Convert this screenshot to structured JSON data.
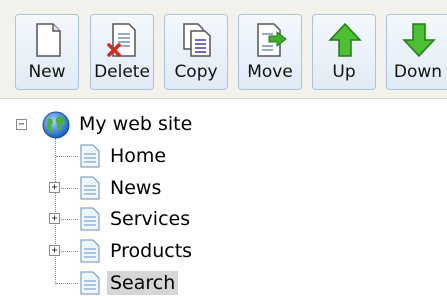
{
  "toolbar": {
    "buttons": [
      {
        "id": "new",
        "label": "New",
        "icon": "new-page-icon"
      },
      {
        "id": "delete",
        "label": "Delete",
        "icon": "delete-page-icon"
      },
      {
        "id": "copy",
        "label": "Copy",
        "icon": "copy-page-icon"
      },
      {
        "id": "move",
        "label": "Move",
        "icon": "move-page-icon"
      },
      {
        "id": "up",
        "label": "Up",
        "icon": "up-arrow-icon"
      },
      {
        "id": "down",
        "label": "Down",
        "icon": "down-arrow-icon"
      }
    ]
  },
  "tree": {
    "root": {
      "label": "My web site",
      "icon": "globe-icon",
      "expanded": true
    },
    "children": [
      {
        "label": "Home",
        "icon": "page-icon",
        "expandable": false,
        "selected": false
      },
      {
        "label": "News",
        "icon": "page-icon",
        "expandable": true,
        "selected": false
      },
      {
        "label": "Services",
        "icon": "page-icon",
        "expandable": true,
        "selected": false
      },
      {
        "label": "Products",
        "icon": "page-icon",
        "expandable": true,
        "selected": false
      },
      {
        "label": "Search",
        "icon": "page-icon",
        "expandable": false,
        "selected": true
      }
    ]
  },
  "colors": {
    "toolbar_bg": "#f2f1ec",
    "button_border": "#a9c2de",
    "selection_bg": "#d6d6d6",
    "arrow_green": "#3fae2a",
    "delete_red": "#d42a1c"
  }
}
